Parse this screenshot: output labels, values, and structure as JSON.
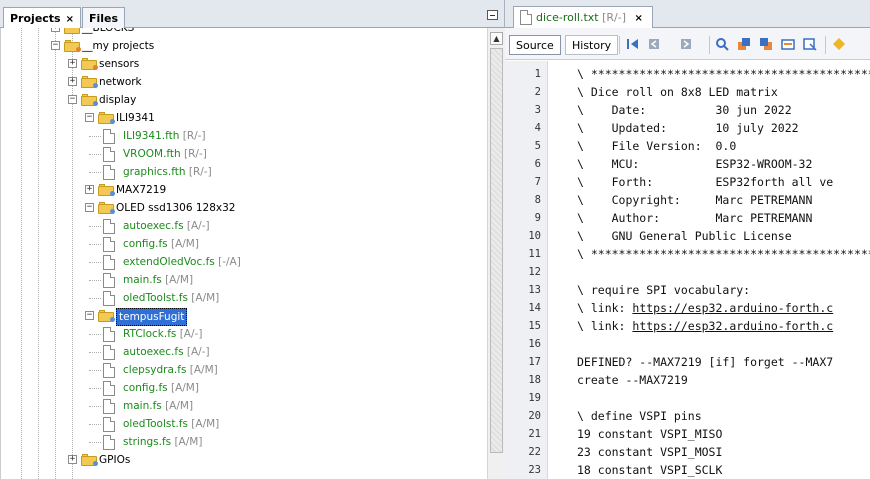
{
  "projects_panel": {
    "tabs": [
      {
        "label": "Projects",
        "close": "×"
      },
      {
        "label": "Files"
      }
    ],
    "tree": [
      {
        "label": "__BLOCKS",
        "kind": "folder",
        "depth": 2,
        "expander": "+",
        "partial": true
      },
      {
        "label": "__my projects",
        "kind": "folder",
        "depth": 2,
        "expander": "-",
        "badge": "o"
      },
      {
        "label": "sensors",
        "kind": "folder",
        "depth": 3,
        "expander": "+",
        "badge": "o"
      },
      {
        "label": "network",
        "kind": "folder",
        "depth": 3,
        "expander": "+",
        "badge": "b"
      },
      {
        "label": "display",
        "kind": "folder",
        "depth": 3,
        "expander": "-",
        "badge": "b"
      },
      {
        "label": "ILI9341",
        "kind": "folder",
        "depth": 4,
        "expander": "-",
        "badge": "b"
      },
      {
        "label": "ILI9341.fth",
        "status": "[R/-]",
        "kind": "file",
        "depth": 5
      },
      {
        "label": "VROOM.fth",
        "status": "[R/-]",
        "kind": "file",
        "depth": 5
      },
      {
        "label": "graphics.fth",
        "status": "[R/-]",
        "kind": "file",
        "depth": 5
      },
      {
        "label": "MAX7219",
        "kind": "folder",
        "depth": 4,
        "expander": "+",
        "badge": "b"
      },
      {
        "label": "OLED ssd1306 128x32",
        "kind": "folder",
        "depth": 4,
        "expander": "-",
        "badge": "b"
      },
      {
        "label": "autoexec.fs",
        "status": "[A/-]",
        "kind": "file",
        "depth": 5
      },
      {
        "label": "config.fs",
        "status": "[A/M]",
        "kind": "file",
        "depth": 5
      },
      {
        "label": "extendOledVoc.fs",
        "status": "[-/A]",
        "kind": "file",
        "depth": 5
      },
      {
        "label": "main.fs",
        "status": "[A/M]",
        "kind": "file",
        "depth": 5
      },
      {
        "label": "oledToolst.fs",
        "status": "[A/M]",
        "kind": "file",
        "depth": 5
      },
      {
        "label": "tempusFugit",
        "kind": "folder",
        "depth": 4,
        "expander": "-",
        "badge": "b",
        "selected": true
      },
      {
        "label": "RTClock.fs",
        "status": "[A/-]",
        "kind": "file",
        "depth": 5
      },
      {
        "label": "autoexec.fs",
        "status": "[A/-]",
        "kind": "file",
        "depth": 5
      },
      {
        "label": "clepsydra.fs",
        "status": "[A/M]",
        "kind": "file",
        "depth": 5
      },
      {
        "label": "config.fs",
        "status": "[A/M]",
        "kind": "file",
        "depth": 5
      },
      {
        "label": "main.fs",
        "status": "[A/M]",
        "kind": "file",
        "depth": 5
      },
      {
        "label": "oledToolst.fs",
        "status": "[A/M]",
        "kind": "file",
        "depth": 5
      },
      {
        "label": "strings.fs",
        "status": "[A/M]",
        "kind": "file",
        "depth": 5
      },
      {
        "label": "GPIOs",
        "kind": "folder",
        "depth": 3,
        "expander": "+",
        "badge": "b"
      }
    ]
  },
  "editor": {
    "tab": {
      "filename": "dice-roll.txt",
      "status": "[R/-]",
      "close": "×"
    },
    "toolbar": {
      "source_label": "Source",
      "history_label": "History"
    },
    "lines": [
      {
        "n": "1",
        "text": "\\ ***********************************************"
      },
      {
        "n": "2",
        "text": "\\ Dice roll on 8x8 LED matrix"
      },
      {
        "n": "3",
        "text": "\\    Date:          30 jun 2022"
      },
      {
        "n": "4",
        "text": "\\    Updated:       10 july 2022"
      },
      {
        "n": "5",
        "text": "\\    File Version:  0.0"
      },
      {
        "n": "6",
        "text": "\\    MCU:           ESP32-WROOM-32"
      },
      {
        "n": "7",
        "text": "\\    Forth:         ESP32forth all ve"
      },
      {
        "n": "8",
        "text": "\\    Copyright:     Marc PETREMANN"
      },
      {
        "n": "9",
        "text": "\\    Author:        Marc PETREMANN"
      },
      {
        "n": "10",
        "text": "\\    GNU General Public License"
      },
      {
        "n": "11",
        "text": "\\ ***********************************************"
      },
      {
        "n": "12",
        "text": ""
      },
      {
        "n": "13",
        "text": "\\ require SPI vocabulary:"
      },
      {
        "n": "14",
        "prefix": "\\ link: ",
        "link": "https://esp32.arduino-forth.c"
      },
      {
        "n": "15",
        "prefix": "\\ link: ",
        "link": "https://esp32.arduino-forth.c"
      },
      {
        "n": "16",
        "text": ""
      },
      {
        "n": "17",
        "text": "DEFINED? --MAX7219 [if] forget --MAX7"
      },
      {
        "n": "18",
        "text": "create --MAX7219"
      },
      {
        "n": "19",
        "text": ""
      },
      {
        "n": "20",
        "text": "\\ define VSPI pins"
      },
      {
        "n": "21",
        "text": "19 constant VSPI_MISO"
      },
      {
        "n": "22",
        "text": "23 constant VSPI_MOSI"
      },
      {
        "n": "23",
        "text": "18 constant VSPI_SCLK"
      }
    ]
  },
  "icons": [
    "folder-icon",
    "file-icon",
    "back-icon",
    "forward-icon",
    "find-icon",
    "toggle-bookmark-icon",
    "next-bookmark-icon",
    "prev-bookmark-icon",
    "shift-left-icon"
  ],
  "colors": {
    "accent": "#2f6fd6",
    "file_text": "#1c8a1c",
    "status_text": "#8a8a8a",
    "folder": "#f2c955"
  }
}
